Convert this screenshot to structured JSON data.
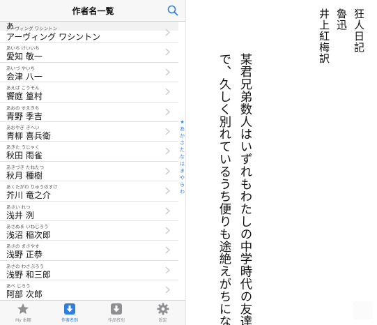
{
  "header": {
    "title": "作者名一覧",
    "search_icon": "search-icon"
  },
  "list": {
    "section_header": "あ",
    "items": [
      {
        "kana": "アーヴィング ワシントン",
        "name": "アーヴィング ワシントン"
      },
      {
        "kana": "あいち けいいち",
        "name": "愛知 敬一"
      },
      {
        "kana": "あいづ やいち",
        "name": "会津 八一"
      },
      {
        "kana": "あえば こうそん",
        "name": "饗庭 篁村"
      },
      {
        "kana": "あおの すえきち",
        "name": "青野 季吉"
      },
      {
        "kana": "あおやぎ きへい",
        "name": "青柳 喜兵衛"
      },
      {
        "kana": "あきた うじゃく",
        "name": "秋田 雨雀"
      },
      {
        "kana": "あきづき たねたつ",
        "name": "秋月 種樹"
      },
      {
        "kana": "あくたがわ りゅうのすけ",
        "name": "芥川 竜之介"
      },
      {
        "kana": "あさい れつ",
        "name": "浅井 洌"
      },
      {
        "kana": "あさぬま いねじろう",
        "name": "浅沼 稲次郎"
      },
      {
        "kana": "あさの まさやす",
        "name": "浅野 正恭"
      },
      {
        "kana": "あさの わさぶろう",
        "name": "浅野 和三郎"
      },
      {
        "kana": "あべ じろう",
        "name": "阿部 次郎"
      }
    ]
  },
  "index_bar": [
    "★",
    "あ",
    "か",
    "さ",
    "た",
    "な",
    "は",
    "ま",
    "や",
    "ら",
    "わ"
  ],
  "tabs": [
    {
      "label": "My 本棚",
      "icon": "star-icon",
      "active": false
    },
    {
      "label": "作者名別",
      "icon": "download-icon",
      "active": true
    },
    {
      "label": "作品名別",
      "icon": "download-icon",
      "active": false
    },
    {
      "label": "設定",
      "icon": "gear-icon",
      "active": false
    }
  ],
  "colors": {
    "accent": "#2f7de1",
    "inactive": "#8e8e93"
  },
  "book": {
    "title": "狂人日記",
    "author": "魯迅",
    "translator": "井上紅梅訳",
    "lines": [
      "某君兄弟数人はいずれもわたしの中学時代の友達",
      "で、久しく別れているうち便りも途絶えがちにな"
    ]
  }
}
